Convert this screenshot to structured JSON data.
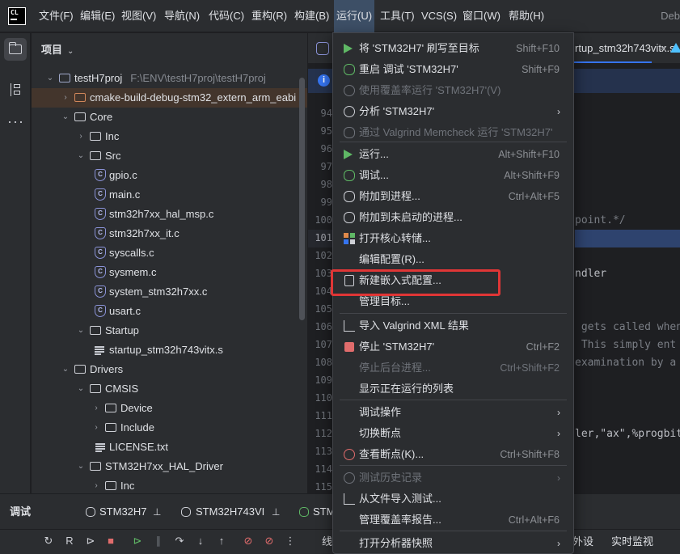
{
  "menubar": {
    "items": [
      "文件(F)",
      "编辑(E)",
      "视图(V)",
      "导航(N)",
      "代码(C)",
      "重构(R)",
      "构建(B)",
      "运行(U)",
      "工具(T)",
      "VCS(S)",
      "窗口(W)",
      "帮助(H)"
    ],
    "active_index": 7,
    "title_right": "Deb"
  },
  "project": {
    "header": "项目",
    "tree": [
      {
        "label": "testH7proj",
        "hint": "F:\\ENV\\testH7proj\\testH7proj",
        "icon": "module-folder-icon",
        "expanded": true
      },
      {
        "label": "cmake-build-debug-stm32_extern_arm_eabi",
        "icon": "excluded-folder-icon",
        "expanded": false
      },
      {
        "label": "Core",
        "icon": "folder-icon",
        "expanded": true
      },
      {
        "label": "Inc",
        "icon": "folder-icon",
        "expanded": false
      },
      {
        "label": "Src",
        "icon": "folder-icon",
        "expanded": true
      },
      {
        "label": "gpio.c",
        "icon": "c-file-icon"
      },
      {
        "label": "main.c",
        "icon": "c-file-icon"
      },
      {
        "label": "stm32h7xx_hal_msp.c",
        "icon": "c-file-icon"
      },
      {
        "label": "stm32h7xx_it.c",
        "icon": "c-file-icon"
      },
      {
        "label": "syscalls.c",
        "icon": "c-file-icon"
      },
      {
        "label": "sysmem.c",
        "icon": "c-file-icon"
      },
      {
        "label": "system_stm32h7xx.c",
        "icon": "c-file-icon"
      },
      {
        "label": "usart.c",
        "icon": "c-file-icon"
      },
      {
        "label": "Startup",
        "icon": "folder-icon",
        "expanded": true
      },
      {
        "label": "startup_stm32h743vitx.s",
        "icon": "asm-file-icon"
      },
      {
        "label": "Drivers",
        "icon": "folder-icon",
        "expanded": true
      },
      {
        "label": "CMSIS",
        "icon": "folder-icon",
        "expanded": true
      },
      {
        "label": "Device",
        "icon": "folder-icon",
        "expanded": false
      },
      {
        "label": "Include",
        "icon": "folder-icon",
        "expanded": false
      },
      {
        "label": "LICENSE.txt",
        "icon": "text-file-icon"
      },
      {
        "label": "STM32H7xx_HAL_Driver",
        "icon": "folder-icon",
        "expanded": true
      },
      {
        "label": "Inc",
        "icon": "folder-icon",
        "expanded": false
      }
    ]
  },
  "editor": {
    "tab_label": "rtup_stm32h743vitx.s",
    "tab_close": "×",
    "line_numbers": [
      "94",
      "95",
      "96",
      "97",
      "98",
      "99",
      "100",
      "101",
      "102",
      "103",
      "104",
      "105",
      "106",
      "107",
      "108",
      "109",
      "110",
      "111",
      "112",
      "113",
      "114",
      "115"
    ],
    "current_line": "101",
    "code_fragments": [
      "point.*/",
      "ndler",
      " gets called when",
      " This simply ent",
      "examination by a",
      "ler,\"ax\",%progbit"
    ]
  },
  "run_menu": {
    "items": [
      {
        "label": "将 'STM32H7' 刷写至目标",
        "shortcut": "Shift+F10",
        "icon": "play-icon",
        "disabled": false
      },
      {
        "label": "重启 调试 'STM32H7'",
        "shortcut": "Shift+F9",
        "icon": "restart-debug-icon",
        "disabled": false
      },
      {
        "label": "使用覆盖率运行 'STM32H7'(V)",
        "shortcut": "",
        "icon": "coverage-icon",
        "disabled": true
      },
      {
        "label": "分析 'STM32H7'",
        "shortcut": "",
        "icon": "profiler-icon",
        "disabled": false,
        "submenu": true
      },
      {
        "label": "通过 Valgrind Memcheck 运行 'STM32H7'",
        "shortcut": "",
        "icon": "valgrind-icon",
        "disabled": true
      },
      {
        "label": "运行...",
        "shortcut": "Alt+Shift+F10",
        "icon": "run-icon",
        "disabled": false
      },
      {
        "label": "调试...",
        "shortcut": "Alt+Shift+F9",
        "icon": "debug-icon",
        "disabled": false
      },
      {
        "label": "附加到进程...",
        "shortcut": "Ctrl+Alt+F5",
        "icon": "attach-process-icon",
        "disabled": false
      },
      {
        "label": "附加到未启动的进程...",
        "shortcut": "",
        "icon": "attach-unstarted-icon",
        "disabled": false
      },
      {
        "label": "打开核心转储...",
        "shortcut": "",
        "icon": "core-dump-icon",
        "disabled": false
      },
      {
        "label": "编辑配置(R)...",
        "shortcut": "",
        "icon": "",
        "disabled": false
      },
      {
        "label": "新建嵌入式配置...",
        "shortcut": "",
        "icon": "chip-icon",
        "disabled": false
      },
      {
        "label": "管理目标...",
        "shortcut": "",
        "icon": "",
        "disabled": false
      },
      {
        "label": "导入 Valgrind XML 结果",
        "shortcut": "",
        "icon": "import-icon",
        "disabled": false
      },
      {
        "label": "停止 'STM32H7'",
        "shortcut": "Ctrl+F2",
        "icon": "stop-icon",
        "disabled": false
      },
      {
        "label": "停止后台进程...",
        "shortcut": "Ctrl+Shift+F2",
        "icon": "",
        "disabled": true
      },
      {
        "label": "显示正在运行的列表",
        "shortcut": "",
        "icon": "",
        "disabled": false
      },
      {
        "label": "调试操作",
        "shortcut": "",
        "icon": "",
        "disabled": false,
        "submenu": true
      },
      {
        "label": "切换断点",
        "shortcut": "",
        "icon": "",
        "disabled": false,
        "submenu": true
      },
      {
        "label": "查看断点(K)...",
        "shortcut": "Ctrl+Shift+F8",
        "icon": "breakpoints-icon",
        "disabled": false
      },
      {
        "label": "测试历史记录",
        "shortcut": "",
        "icon": "history-icon",
        "disabled": true,
        "submenu": true
      },
      {
        "label": "从文件导入测试...",
        "shortcut": "",
        "icon": "import-icon",
        "disabled": false
      },
      {
        "label": "管理覆盖率报告...",
        "shortcut": "Ctrl+Alt+F6",
        "icon": "",
        "disabled": false
      },
      {
        "label": "打开分析器快照",
        "shortcut": "",
        "icon": "",
        "disabled": false,
        "submenu": true
      }
    ],
    "submenu_arrow": "›"
  },
  "debug_panel": {
    "title": "调试",
    "tabs": [
      "STM32H7",
      "STM32H743VI",
      "STM"
    ],
    "bottom_left_label": "线",
    "bottom_right_labels": [
      "外设",
      "实时监视"
    ]
  },
  "colors": {
    "accent": "#3574f0",
    "menu_active": "#3d4f66",
    "highlight_box": "#e03636",
    "run_green": "#5fb865",
    "stop_red": "#e06c6c"
  }
}
